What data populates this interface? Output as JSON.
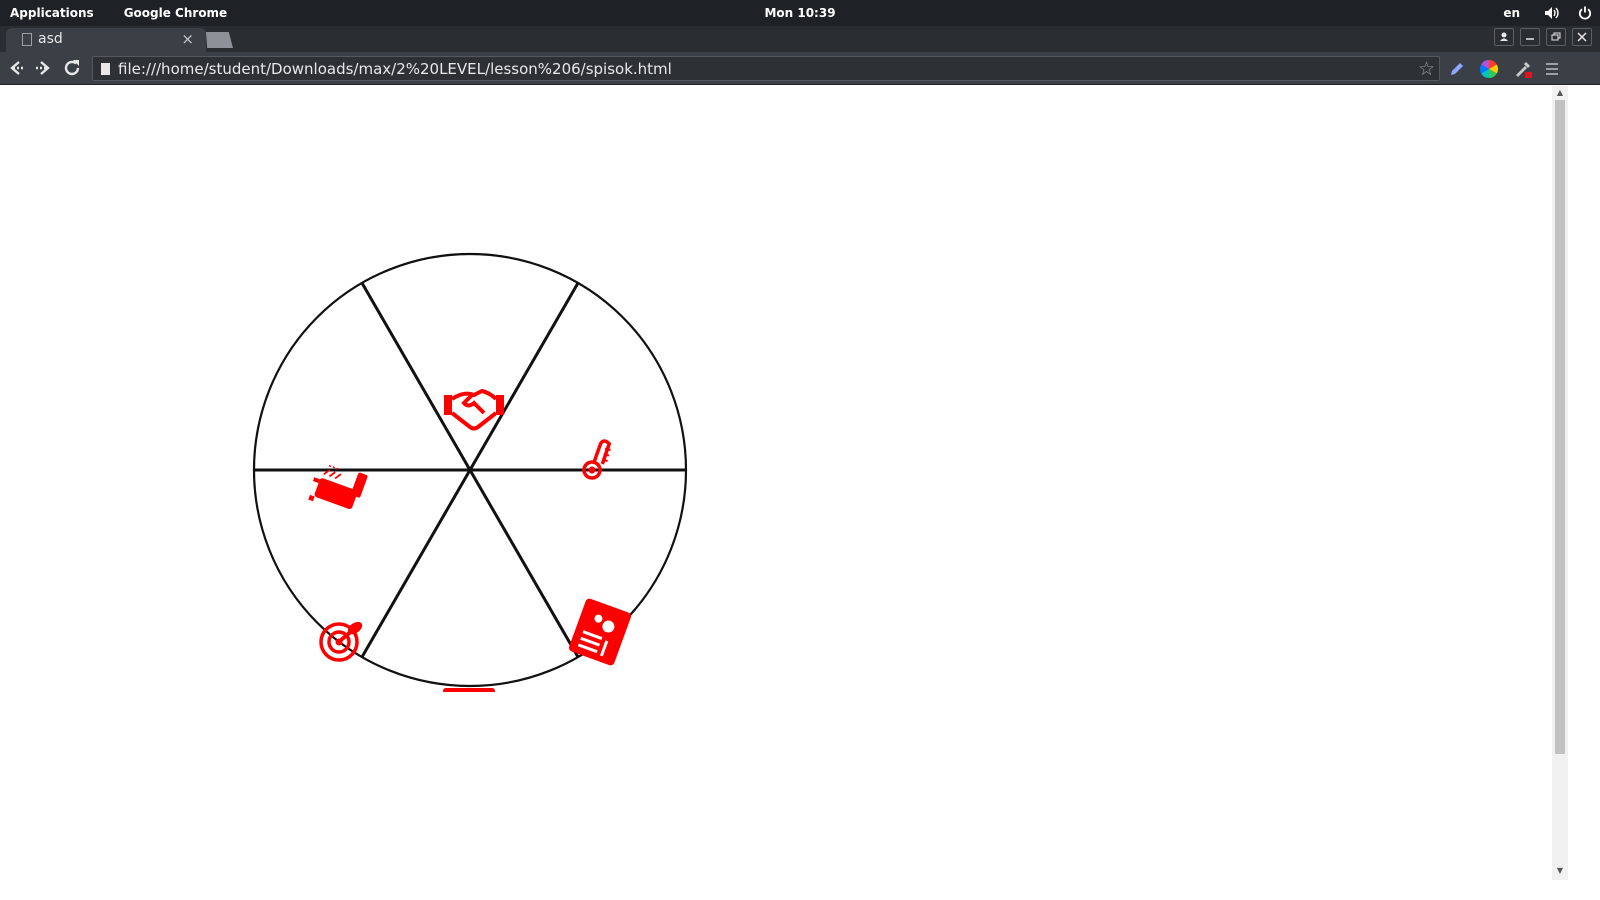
{
  "os": {
    "applications_label": "Applications",
    "app_name": "Google Chrome",
    "clock": "Mon 10:39",
    "lang": "en"
  },
  "browser": {
    "tab_title": "asd",
    "tab_close": "×",
    "url": "file:///home/student/Downloads/max/2%20LEVEL/lesson%206/spisok.html",
    "window_buttons": [
      "user-icon",
      "minimize-icon",
      "restore-icon",
      "close-icon"
    ],
    "extensions": [
      "pencil-icon",
      "color-wheel-icon",
      "eyedropper-icon",
      "menu-icon"
    ]
  },
  "page": {
    "wheel_segments": [
      {
        "icon": "handshake-icon"
      },
      {
        "icon": "thermometer-icon"
      },
      {
        "icon": "id-card-icon"
      },
      {
        "icon": "license-card-icon"
      },
      {
        "icon": "target-icon"
      },
      {
        "icon": "bathtub-icon"
      }
    ],
    "colors": {
      "icon": "#ff0000",
      "stroke": "#111111",
      "panel": "#1e2125",
      "toolbar": "#3b3f46"
    }
  }
}
